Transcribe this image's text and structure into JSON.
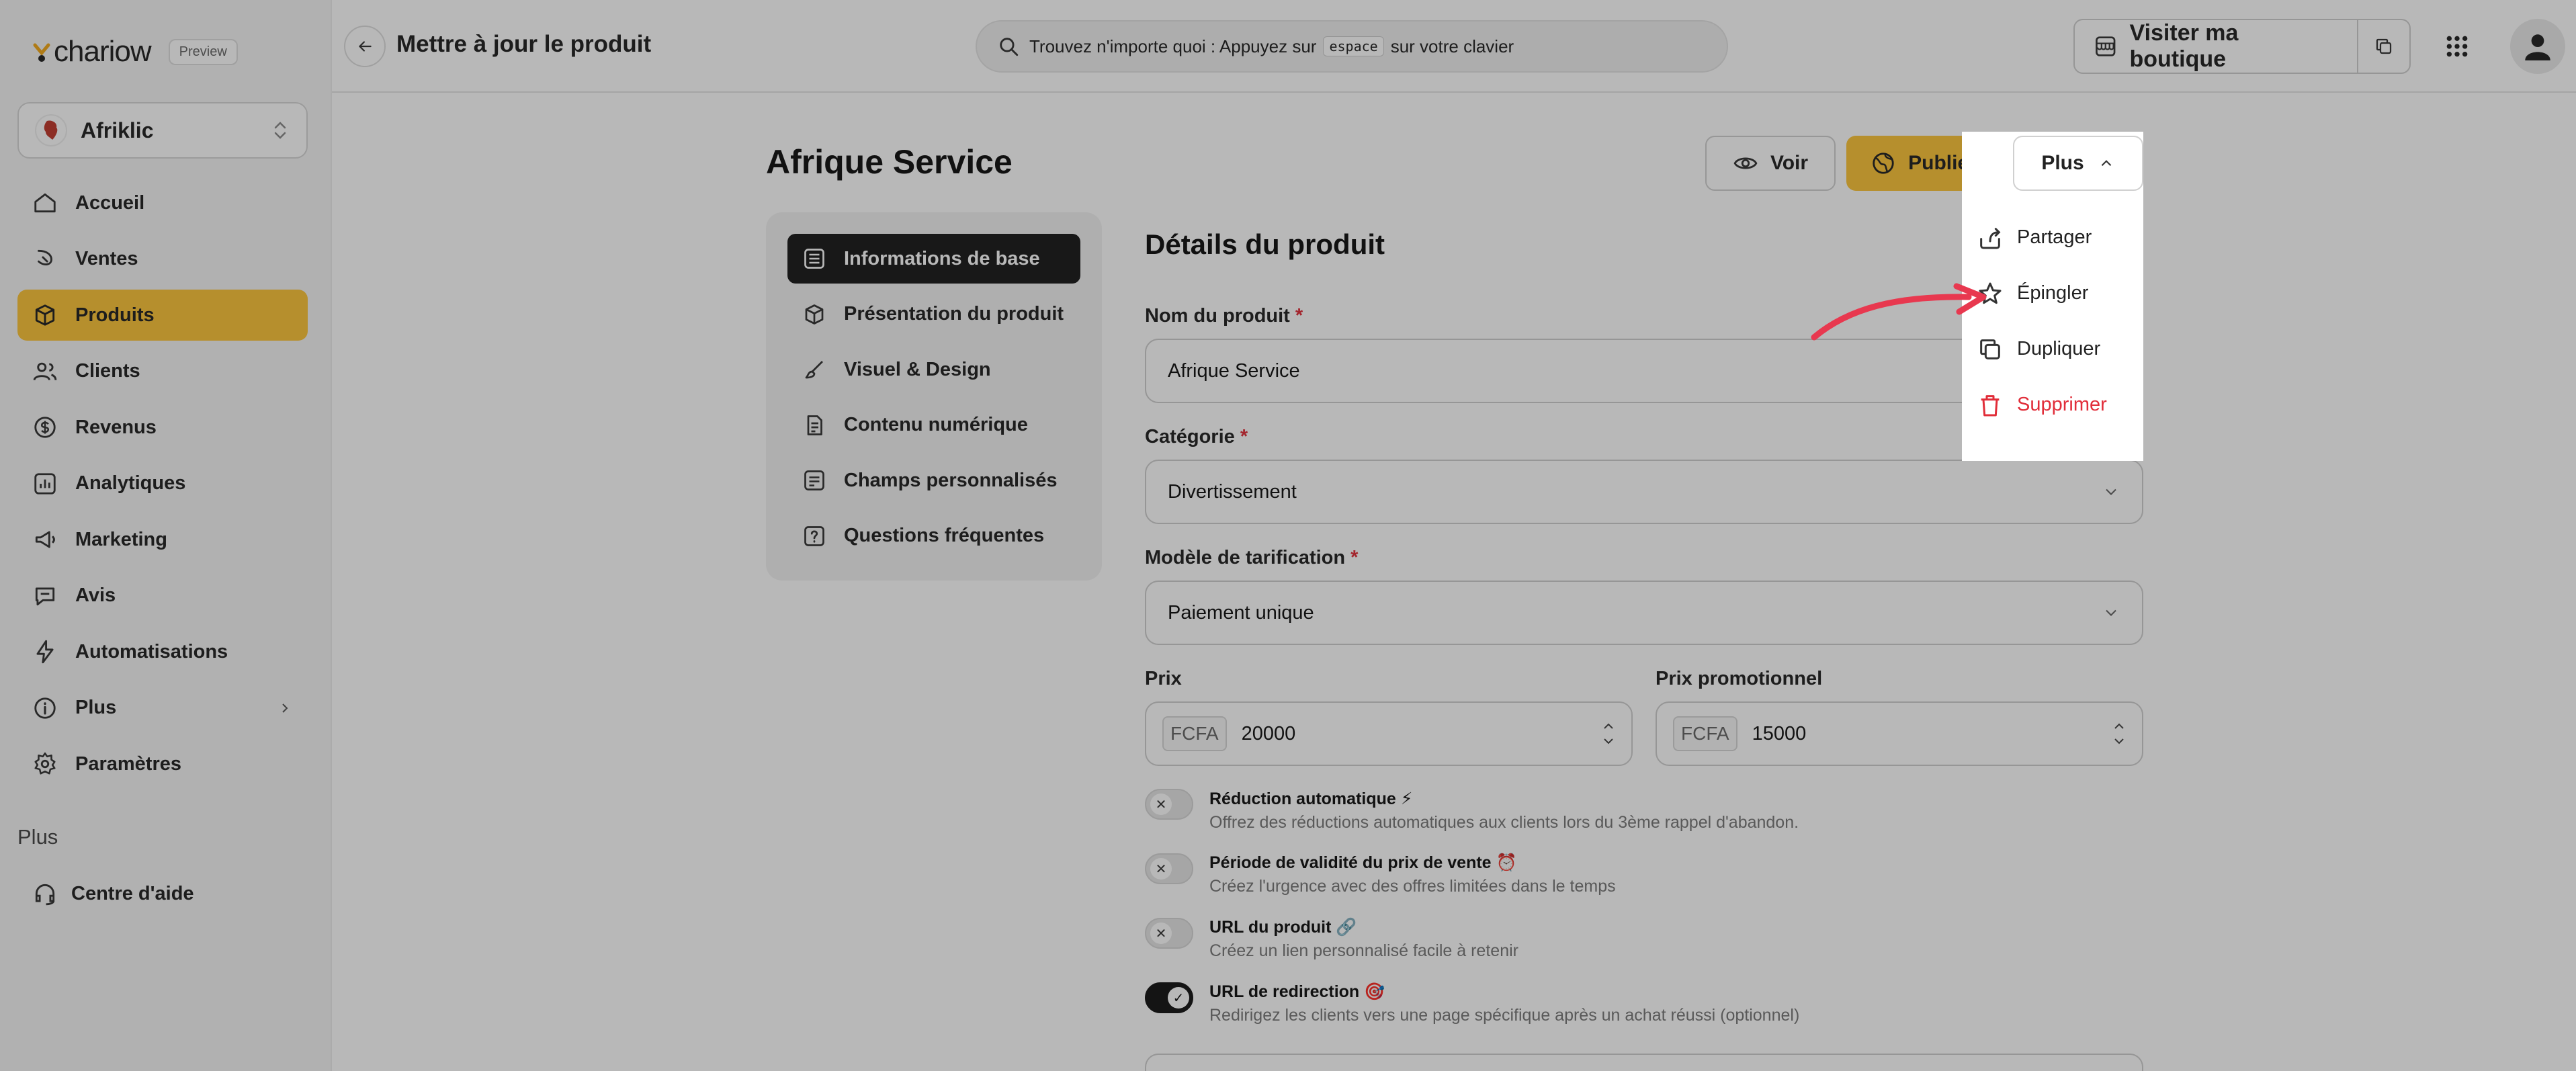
{
  "brand": {
    "name": "chariow",
    "badge": "Preview"
  },
  "store": {
    "name": "Afriklic",
    "avatar_text": "AFRIKLIC"
  },
  "nav": {
    "items": [
      {
        "label": "Accueil",
        "icon": "home-icon"
      },
      {
        "label": "Ventes",
        "icon": "sales-icon"
      },
      {
        "label": "Produits",
        "icon": "box-icon",
        "active": true
      },
      {
        "label": "Clients",
        "icon": "users-icon"
      },
      {
        "label": "Revenus",
        "icon": "money-icon"
      },
      {
        "label": "Analytiques",
        "icon": "chart-icon"
      },
      {
        "label": "Marketing",
        "icon": "megaphone-icon"
      },
      {
        "label": "Avis",
        "icon": "review-icon"
      },
      {
        "label": "Automatisations",
        "icon": "bolt-icon"
      },
      {
        "label": "Plus",
        "icon": "info-icon"
      },
      {
        "label": "Paramètres",
        "icon": "gear-icon"
      }
    ],
    "section_label": "Plus",
    "help": "Centre d'aide"
  },
  "topbar": {
    "title": "Mettre à jour le produit",
    "search_before": "Trouvez n'importe quoi : Appuyez sur",
    "search_key": "espace",
    "search_after": "sur votre clavier",
    "visit_label": "Visiter ma boutique"
  },
  "product": {
    "title": "Afrique Service",
    "voir": "Voir",
    "publier": "Publier",
    "plus": "Plus"
  },
  "tabs": [
    {
      "label": "Informations de base",
      "active": true
    },
    {
      "label": "Présentation du produit"
    },
    {
      "label": "Visuel & Design"
    },
    {
      "label": "Contenu numérique"
    },
    {
      "label": "Champs personnalisés"
    },
    {
      "label": "Questions fréquentes"
    }
  ],
  "form": {
    "section_title": "Détails du produit",
    "name_label": "Nom du produit",
    "name_value": "Afrique Service",
    "category_label": "Catégorie",
    "category_value": "Divertissement",
    "pricing_label": "Modèle de tarification",
    "pricing_value": "Paiement unique",
    "price_label": "Prix",
    "price_currency": "FCFA",
    "price_value": "20000",
    "promo_label": "Prix promotionnel",
    "promo_currency": "FCFA",
    "promo_value": "15000",
    "required_mark": "*",
    "toggles": [
      {
        "title": "Réduction automatique ⚡",
        "desc": "Offrez des réductions automatiques aux clients lors du 3ème rappel d'abandon.",
        "on": false
      },
      {
        "title": "Période de validité du prix de vente ⏰",
        "desc": "Créez l'urgence avec des offres limitées dans le temps",
        "on": false
      },
      {
        "title": "URL du produit 🔗",
        "desc": "Créez un lien personnalisé facile à retenir",
        "on": false
      },
      {
        "title": "URL de redirection 🎯",
        "desc": "Redirigez les clients vers une page spécifique après un achat réussi (optionnel)",
        "on": true
      }
    ]
  },
  "menu": {
    "items": [
      {
        "label": "Partager",
        "icon": "share-icon"
      },
      {
        "label": "Épingler",
        "icon": "star-icon"
      },
      {
        "label": "Dupliquer",
        "icon": "duplicate-icon"
      },
      {
        "label": "Supprimer",
        "icon": "trash-icon",
        "danger": true
      }
    ]
  },
  "colors": {
    "accent": "#fdc438",
    "danger": "#e12d39",
    "arrow": "#e8384f"
  }
}
